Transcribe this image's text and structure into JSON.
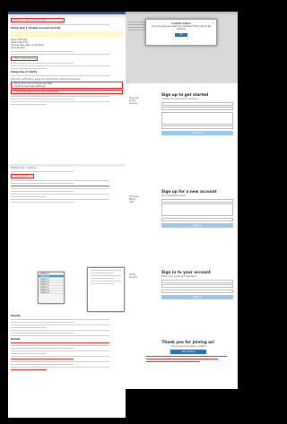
{
  "left_doc": {
    "browser_tab": "Sign up – Account Security",
    "heading_1": "Setup step 1: Enable account security",
    "list_1": [
      "Open Settings",
      "Select Security",
      "Choose Two-step verification",
      "Click Enable"
    ],
    "note": "Note: keep backup codes",
    "heading_2": "Setup step 2: Verify",
    "instructions": [
      "Visit the verification page and follow the instructions below.",
      "Enter the code received via SMS.",
      "Confirm and save settings.",
      "Use the authenticator app if available."
    ],
    "page2_title": "Preferences – Options",
    "dropdown_label": "Select option",
    "dropdown_items": [
      "Option A",
      "Option B",
      "Option C",
      "Option D",
      "Option E",
      "Option F",
      "Option G",
      "Option H"
    ],
    "dropdown_selected": "Option B",
    "bottom_heading": "Results",
    "bottom_heading_2": "Details"
  },
  "right_doc": {
    "modal_title": "Confirm action",
    "modal_text": "Are you sure you want to continue? This cannot be undone.",
    "modal_ok": "OK",
    "card1": {
      "title": "Sign up to get started",
      "sub": "Create your account to continue",
      "button": "Continue"
    },
    "card2": {
      "title": "Sign up for a new account",
      "sub": "Fill in the fields below",
      "button": "Sign up"
    },
    "card3": {
      "title": "Sign in to your account",
      "sub": "Enter your email and password",
      "button": "Sign in"
    },
    "card4": {
      "title": "Thank you for joining us!",
      "sub": "Your account has been created",
      "button": "Get started"
    },
    "sidebar_items": [
      "Overview",
      "Profile",
      "Security",
      "Billing",
      "Help"
    ]
  }
}
